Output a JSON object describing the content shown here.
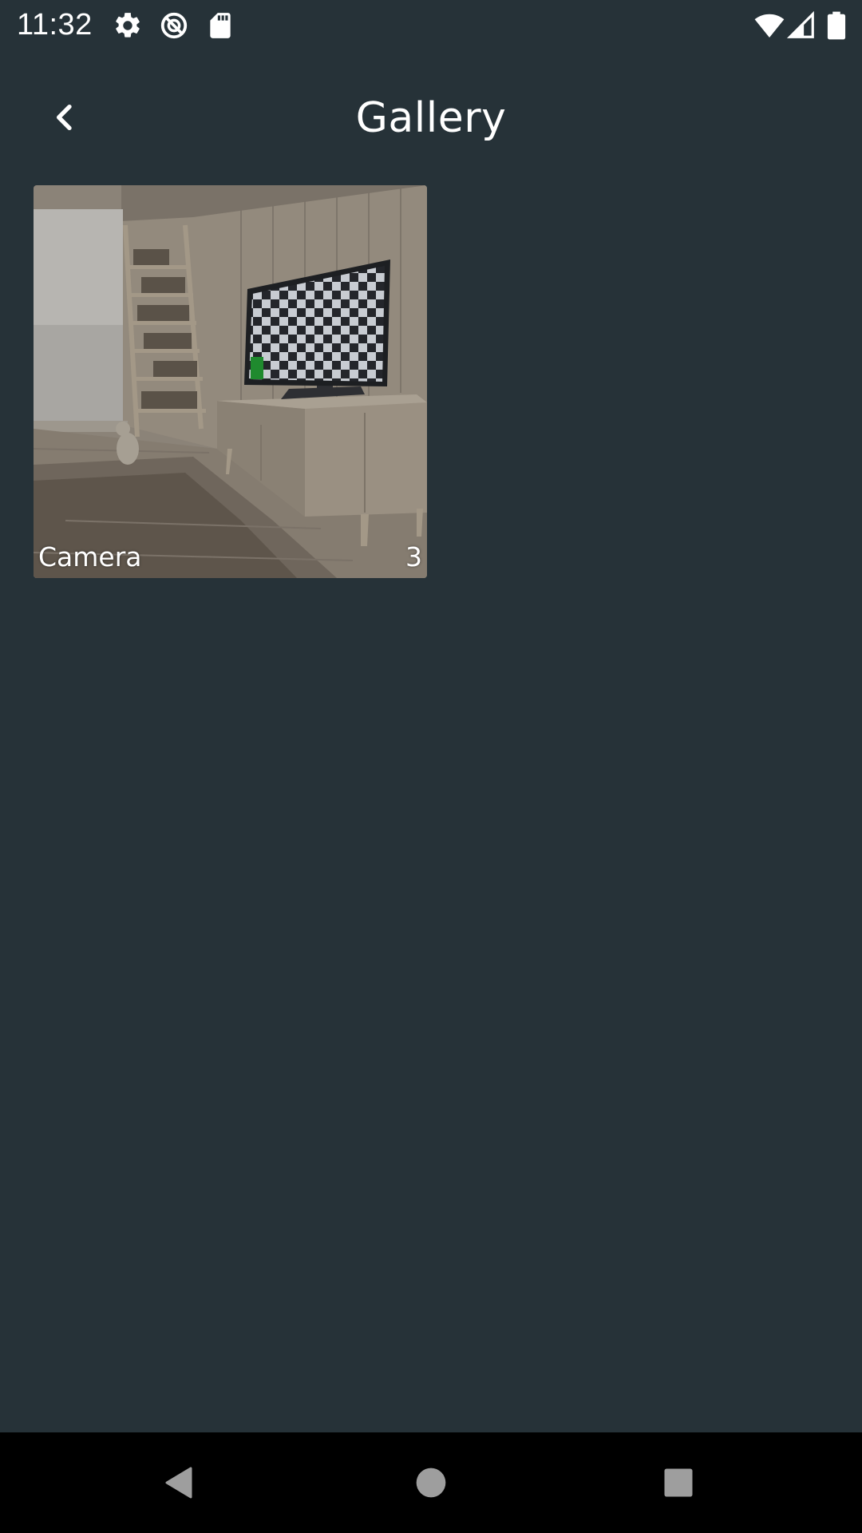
{
  "status_bar": {
    "time": "11:32",
    "icons": [
      "settings-icon",
      "sync-disabled-icon",
      "sd-card-icon",
      "wifi-icon",
      "cell-signal-icon",
      "battery-icon"
    ]
  },
  "toolbar": {
    "title": "Gallery",
    "back_icon": "chevron-left-icon"
  },
  "albums": [
    {
      "name": "Camera",
      "count": "3",
      "thumbnail": "living-room-tv-checkerboard-photo"
    }
  ],
  "nav_bar": {
    "buttons": [
      "back-triangle-icon",
      "home-circle-icon",
      "recents-square-icon"
    ]
  },
  "colors": {
    "background": "#263238",
    "nav_background": "#000000",
    "text": "#ffffff",
    "nav_icon": "#9e9e9e"
  }
}
